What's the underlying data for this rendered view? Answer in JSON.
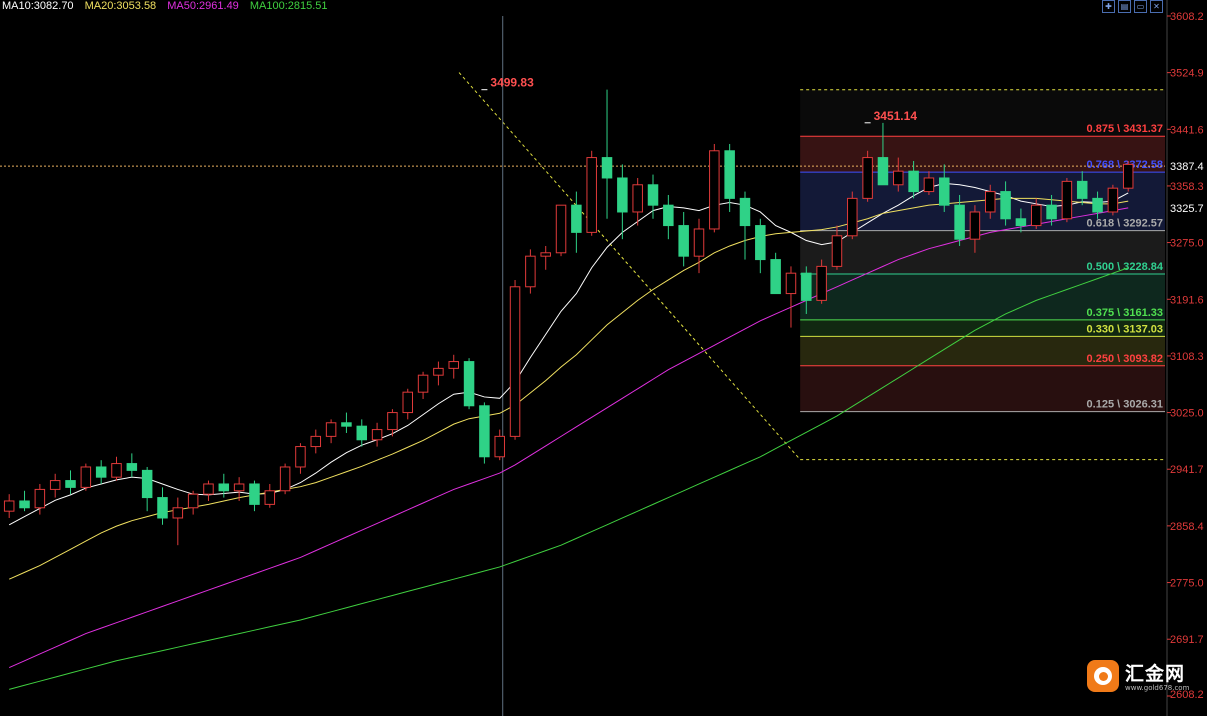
{
  "legend": [
    {
      "label": "MA10:3082.70",
      "color": "#ffffff"
    },
    {
      "label": "MA20:3053.58",
      "color": "#f0e060"
    },
    {
      "label": "MA50:2961.49",
      "color": "#e030e0"
    },
    {
      "label": "MA100:2815.51",
      "color": "#40d040"
    }
  ],
  "toolbar": [
    "crosshair-icon",
    "doc-icon",
    "window-icon",
    "close-icon"
  ],
  "colors": {
    "up": "#e03a3a",
    "down": "#2fd287",
    "grid": "#333333",
    "axis": "#e03a3a",
    "price": "#e8b060"
  },
  "chart_data": {
    "type": "candlestick",
    "y_range": [
      2608.2,
      3608.2
    ],
    "y_ticks": [
      "3608.2",
      "3524.9",
      "3441.6",
      "3358.3",
      "3275.0",
      "3191.6",
      "3108.3",
      "3025.0",
      "2941.7",
      "2858.4",
      "2775.0",
      "2691.7",
      "2608.2"
    ],
    "current_price_label": "3387.4",
    "current_price": 3387.4,
    "secondary_label": "3325.7",
    "secondary_value": 3325.7,
    "high_labels": [
      {
        "text": "3499.83",
        "index": 31,
        "value": 3499.83
      },
      {
        "text": "3451.14",
        "index": 56,
        "value": 3451.14
      }
    ],
    "candles": [
      [
        2880,
        2905,
        2870,
        2895
      ],
      [
        2895,
        2910,
        2880,
        2885
      ],
      [
        2885,
        2920,
        2875,
        2912
      ],
      [
        2912,
        2935,
        2900,
        2925
      ],
      [
        2925,
        2940,
        2905,
        2915
      ],
      [
        2915,
        2950,
        2910,
        2945
      ],
      [
        2945,
        2955,
        2920,
        2930
      ],
      [
        2930,
        2960,
        2925,
        2950
      ],
      [
        2950,
        2965,
        2930,
        2940
      ],
      [
        2940,
        2945,
        2880,
        2900
      ],
      [
        2900,
        2915,
        2860,
        2870
      ],
      [
        2870,
        2900,
        2830,
        2885
      ],
      [
        2885,
        2910,
        2875,
        2905
      ],
      [
        2905,
        2925,
        2895,
        2920
      ],
      [
        2920,
        2935,
        2900,
        2910
      ],
      [
        2910,
        2930,
        2895,
        2920
      ],
      [
        2920,
        2925,
        2880,
        2890
      ],
      [
        2890,
        2920,
        2885,
        2910
      ],
      [
        2910,
        2950,
        2905,
        2945
      ],
      [
        2945,
        2980,
        2935,
        2975
      ],
      [
        2975,
        3000,
        2965,
        2990
      ],
      [
        2990,
        3015,
        2980,
        3010
      ],
      [
        3010,
        3025,
        2995,
        3005
      ],
      [
        3005,
        3015,
        2975,
        2985
      ],
      [
        2985,
        3010,
        2975,
        3000
      ],
      [
        3000,
        3030,
        2990,
        3025
      ],
      [
        3025,
        3060,
        3015,
        3055
      ],
      [
        3055,
        3085,
        3045,
        3080
      ],
      [
        3080,
        3100,
        3065,
        3090
      ],
      [
        3090,
        3110,
        3075,
        3100
      ],
      [
        3100,
        3105,
        3030,
        3035
      ],
      [
        3035,
        3040,
        2950,
        2960
      ],
      [
        2960,
        3000,
        2955,
        2990
      ],
      [
        2990,
        3220,
        2985,
        3210
      ],
      [
        3210,
        3265,
        3200,
        3255
      ],
      [
        3255,
        3270,
        3235,
        3260
      ],
      [
        3260,
        3320,
        3255,
        3330
      ],
      [
        3330,
        3350,
        3260,
        3290
      ],
      [
        3290,
        3410,
        3285,
        3400
      ],
      [
        3400,
        3500,
        3310,
        3370
      ],
      [
        3370,
        3390,
        3280,
        3320
      ],
      [
        3320,
        3370,
        3300,
        3360
      ],
      [
        3360,
        3375,
        3310,
        3330
      ],
      [
        3330,
        3345,
        3280,
        3300
      ],
      [
        3300,
        3320,
        3240,
        3255
      ],
      [
        3255,
        3310,
        3230,
        3295
      ],
      [
        3295,
        3420,
        3290,
        3410
      ],
      [
        3410,
        3420,
        3320,
        3340
      ],
      [
        3340,
        3350,
        3250,
        3300
      ],
      [
        3300,
        3310,
        3230,
        3250
      ],
      [
        3250,
        3260,
        3220,
        3200
      ],
      [
        3200,
        3240,
        3150,
        3230
      ],
      [
        3230,
        3240,
        3170,
        3190
      ],
      [
        3190,
        3250,
        3185,
        3240
      ],
      [
        3240,
        3300,
        3235,
        3285
      ],
      [
        3285,
        3350,
        3280,
        3340
      ],
      [
        3340,
        3410,
        3335,
        3400
      ],
      [
        3400,
        3451,
        3385,
        3360
      ],
      [
        3360,
        3400,
        3350,
        3380
      ],
      [
        3380,
        3395,
        3340,
        3350
      ],
      [
        3350,
        3380,
        3345,
        3370
      ],
      [
        3370,
        3390,
        3320,
        3330
      ],
      [
        3330,
        3345,
        3270,
        3280
      ],
      [
        3280,
        3330,
        3260,
        3320
      ],
      [
        3320,
        3360,
        3310,
        3350
      ],
      [
        3350,
        3365,
        3300,
        3310
      ],
      [
        3310,
        3325,
        3290,
        3300
      ],
      [
        3300,
        3340,
        3295,
        3330
      ],
      [
        3330,
        3345,
        3300,
        3310
      ],
      [
        3310,
        3370,
        3305,
        3365
      ],
      [
        3365,
        3380,
        3330,
        3340
      ],
      [
        3340,
        3350,
        3310,
        3320
      ],
      [
        3320,
        3360,
        3315,
        3355
      ],
      [
        3355,
        3395,
        3350,
        3390
      ]
    ],
    "moving_averages": [
      {
        "name": "MA10",
        "color": "#ffffff",
        "values": [
          2860,
          2872,
          2884,
          2896,
          2904,
          2914,
          2920,
          2926,
          2930,
          2928,
          2920,
          2912,
          2905,
          2904,
          2906,
          2908,
          2905,
          2906,
          2912,
          2922,
          2936,
          2952,
          2966,
          2977,
          2985,
          2994,
          3006,
          3022,
          3038,
          3052,
          3055,
          3048,
          3046,
          3070,
          3106,
          3140,
          3174,
          3200,
          3238,
          3268,
          3290,
          3306,
          3322,
          3328,
          3326,
          3322,
          3330,
          3334,
          3330,
          3320,
          3300,
          3290,
          3278,
          3272,
          3276,
          3290,
          3304,
          3318,
          3330,
          3344,
          3356,
          3362,
          3360,
          3356,
          3350,
          3344,
          3336,
          3332,
          3328,
          3330,
          3335,
          3334,
          3336,
          3348
        ]
      },
      {
        "name": "MA20",
        "color": "#f0e060",
        "values": [
          2780,
          2790,
          2800,
          2812,
          2824,
          2836,
          2848,
          2858,
          2866,
          2872,
          2878,
          2882,
          2886,
          2890,
          2895,
          2900,
          2904,
          2908,
          2912,
          2916,
          2922,
          2930,
          2938,
          2946,
          2955,
          2964,
          2974,
          2984,
          2996,
          3008,
          3016,
          3020,
          3024,
          3036,
          3054,
          3072,
          3092,
          3110,
          3132,
          3154,
          3172,
          3190,
          3206,
          3220,
          3234,
          3246,
          3260,
          3270,
          3278,
          3284,
          3288,
          3290,
          3292,
          3294,
          3298,
          3304,
          3310,
          3318,
          3322,
          3326,
          3330,
          3332,
          3334,
          3336,
          3338,
          3340,
          3340,
          3340,
          3338,
          3336,
          3334,
          3332,
          3332,
          3336
        ]
      },
      {
        "name": "MA50",
        "color": "#e030e0",
        "values": [
          2650,
          2660,
          2670,
          2680,
          2690,
          2700,
          2708,
          2716,
          2724,
          2732,
          2740,
          2748,
          2756,
          2764,
          2772,
          2780,
          2788,
          2796,
          2804,
          2812,
          2822,
          2832,
          2842,
          2852,
          2862,
          2872,
          2882,
          2892,
          2902,
          2912,
          2920,
          2928,
          2936,
          2948,
          2962,
          2976,
          2990,
          3004,
          3018,
          3032,
          3046,
          3060,
          3074,
          3088,
          3100,
          3112,
          3124,
          3136,
          3148,
          3160,
          3170,
          3180,
          3190,
          3200,
          3210,
          3220,
          3230,
          3240,
          3250,
          3258,
          3266,
          3272,
          3278,
          3284,
          3290,
          3294,
          3298,
          3302,
          3306,
          3310,
          3314,
          3318,
          3322,
          3326
        ]
      },
      {
        "name": "MA100",
        "color": "#40d040",
        "values": [
          2618,
          2624,
          2630,
          2636,
          2642,
          2648,
          2654,
          2660,
          2665,
          2670,
          2675,
          2680,
          2685,
          2690,
          2695,
          2700,
          2705,
          2710,
          2715,
          2720,
          2726,
          2732,
          2738,
          2744,
          2750,
          2756,
          2762,
          2768,
          2774,
          2780,
          2786,
          2792,
          2798,
          2806,
          2814,
          2822,
          2830,
          2840,
          2850,
          2860,
          2870,
          2880,
          2890,
          2900,
          2910,
          2920,
          2930,
          2940,
          2950,
          2960,
          2972,
          2984,
          2996,
          3008,
          3020,
          3034,
          3048,
          3062,
          3076,
          3090,
          3104,
          3118,
          3132,
          3146,
          3158,
          3170,
          3180,
          3190,
          3198,
          3206,
          3214,
          3222,
          3230,
          3238
        ]
      }
    ],
    "fibonacci": {
      "high": 3499.83,
      "low": 2955.9,
      "start_index": 52,
      "levels": [
        {
          "label": "0.875 \\ 3431.37",
          "value": 3431.37,
          "color": "#ff4040",
          "fill": "#3a1414"
        },
        {
          "label": "0.768 \\ 3372.58",
          "value": 3378.58,
          "color": "#4050ff",
          "fill": "#141a3a"
        },
        {
          "label": "0.618 \\ 3292.57",
          "value": 3292.57,
          "color": "#aaaaaa",
          "fill": "#1c1c1c"
        },
        {
          "label": "0.500 \\ 3228.84",
          "value": 3228.84,
          "color": "#30d090",
          "fill": "#0f2a20"
        },
        {
          "label": "0.375 \\ 3161.33",
          "value": 3161.33,
          "color": "#50e050",
          "fill": "#122a12"
        },
        {
          "label": "0.330 \\ 3137.03",
          "value": 3137.03,
          "color": "#d0e040",
          "fill": "#2a2a0f"
        },
        {
          "label": "0.250 \\ 3093.82",
          "value": 3093.82,
          "color": "#ff4040",
          "fill": "#2a1010"
        },
        {
          "label": "0.125 \\ 3026.31",
          "value": 3026.31,
          "color": "#aaaaaa",
          "fill": "#1a1a1a"
        }
      ]
    }
  },
  "watermark": {
    "name": "汇金网",
    "url": "www.gold678.com"
  }
}
